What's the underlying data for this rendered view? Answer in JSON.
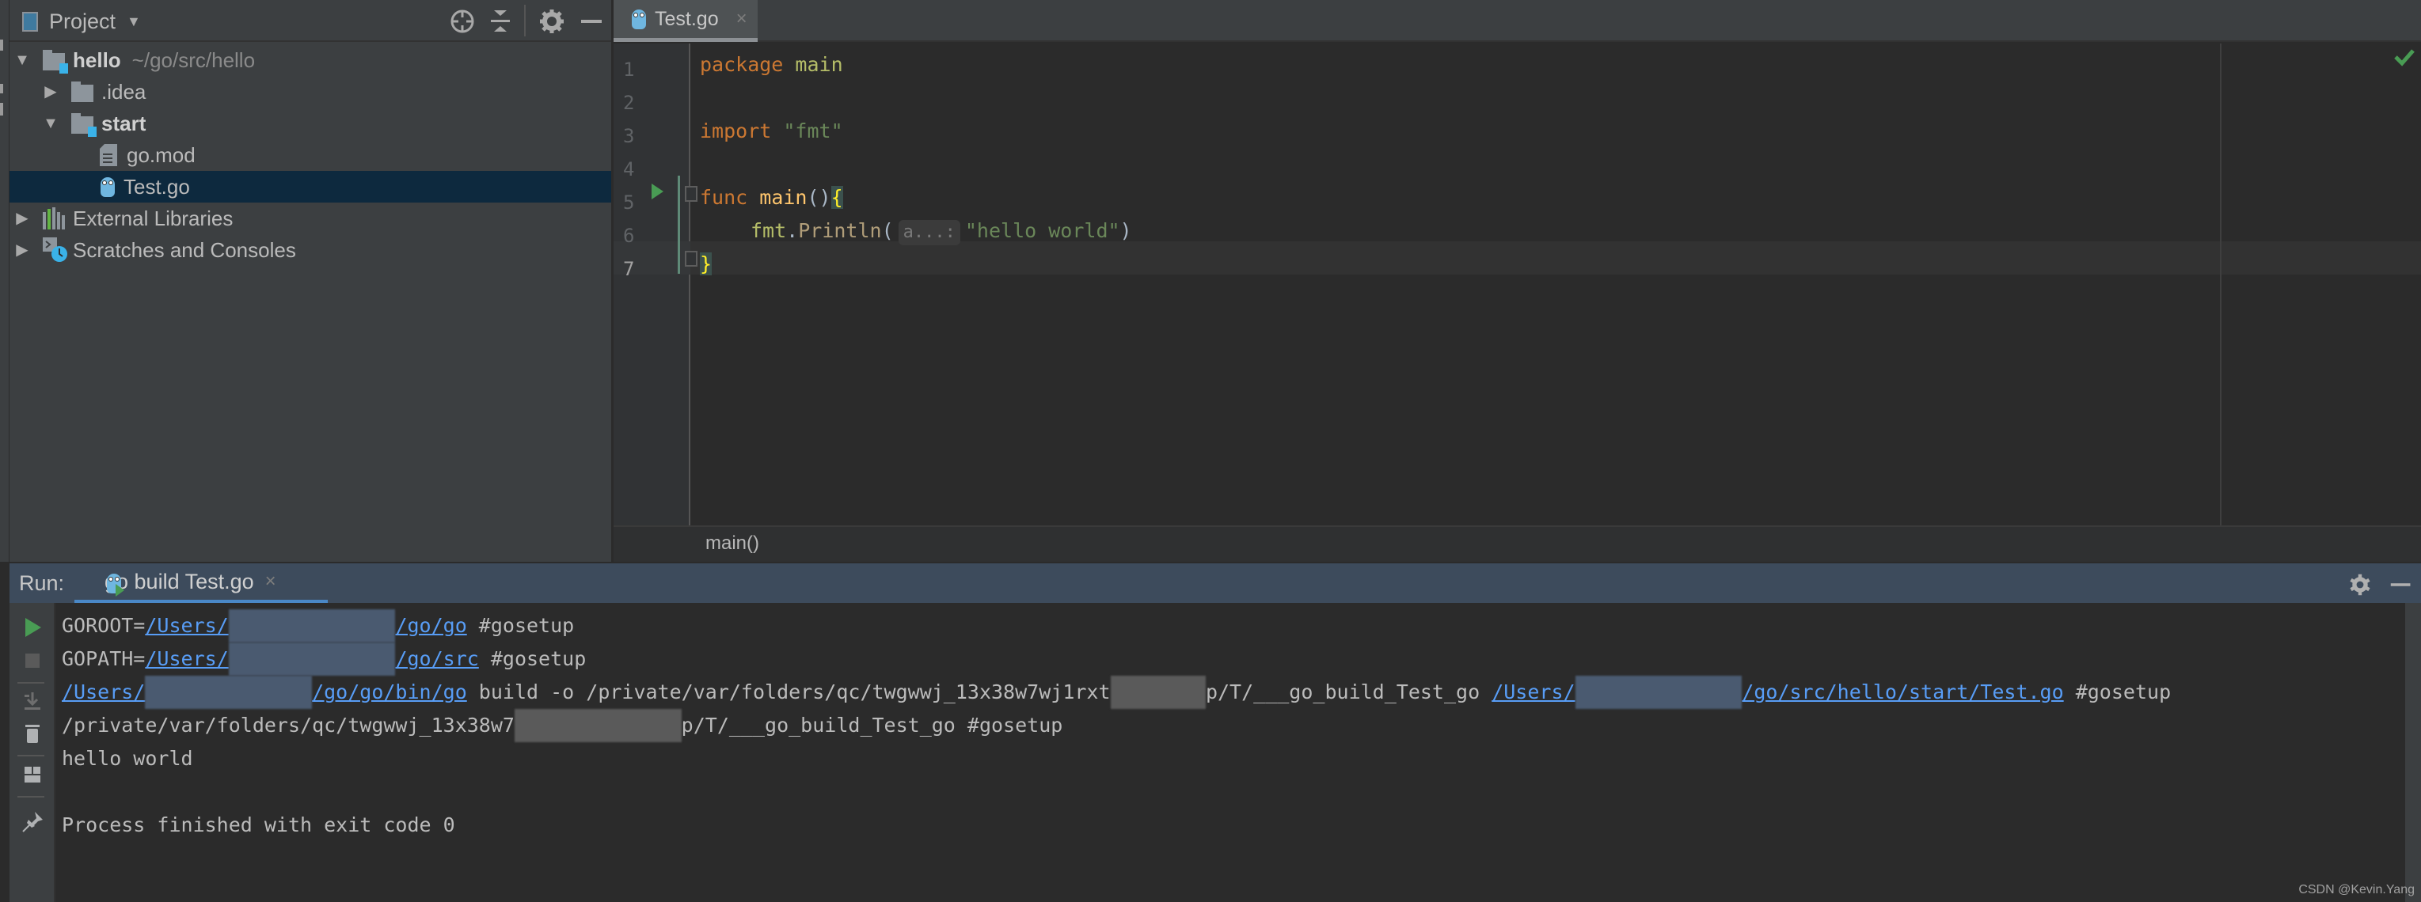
{
  "project_panel": {
    "title": "Project",
    "header_icons": [
      "locate-icon",
      "collapse-all-icon",
      "gear-icon",
      "minimize-icon"
    ],
    "tree": [
      {
        "label": "hello",
        "detail": "~/go/src/hello",
        "type": "module-folder",
        "expanded": true,
        "depth": 0
      },
      {
        "label": ".idea",
        "type": "folder",
        "expanded": false,
        "depth": 1
      },
      {
        "label": "start",
        "type": "module-folder",
        "expanded": true,
        "depth": 1
      },
      {
        "label": "go.mod",
        "type": "file",
        "depth": 2
      },
      {
        "label": "Test.go",
        "type": "go-file",
        "depth": 2,
        "selected": true
      },
      {
        "label": "External Libraries",
        "type": "libraries",
        "expanded": false,
        "depth": 0
      },
      {
        "label": "Scratches and Consoles",
        "type": "scratches",
        "expanded": false,
        "depth": 0
      }
    ]
  },
  "editor": {
    "tab": {
      "label": "Test.go",
      "close": "×"
    },
    "line_numbers": [
      "1",
      "2",
      "3",
      "4",
      "5",
      "6",
      "7"
    ],
    "current_line": 7,
    "code": {
      "l1_kw": "package",
      "l1_name": "main",
      "l3_kw": "import",
      "l3_str": "\"fmt\"",
      "l5_kw": "func",
      "l5_fn": "main",
      "l5_parens": "()",
      "l5_brace": "{",
      "l6_pkg": "fmt",
      "l6_dot": ".",
      "l6_call": "Println",
      "l6_open": "(",
      "l6_hint": "a...:",
      "l6_str": "\"hello world\"",
      "l6_close": ")",
      "l7_brace": "}"
    },
    "breadcrumb": "main()",
    "inspection_status": "ok"
  },
  "run_panel": {
    "label": "Run:",
    "tab": {
      "label": "go build Test.go",
      "close": "×"
    },
    "console": {
      "l1_prefix": "GOROOT=",
      "l1_link_a": "/Users/",
      "l1_redacted": "xxxxxxxxxxxxxx",
      "l1_link_b": "/go/go",
      "l1_suffix": " #gosetup",
      "l2_prefix": "GOPATH=",
      "l2_link_a": "/Users/",
      "l2_redacted": "xxxxxxxxxxxxxx",
      "l2_link_b": "/go/src",
      "l2_suffix": " #gosetup",
      "l3_link_a": "/Users/",
      "l3_redacted": "xxxxxxxxxxxxxx",
      "l3_link_b": "/go/go/bin/go",
      "l3_mid": " build -o /private/var/folders/qc/twgwwj_13x38w7wj1rxt",
      "l3_redacted2": "xxxxxxxx",
      "l3_mid2": "p/T/___go_build_Test_go ",
      "l3_link2_a": "/Users/",
      "l3_redacted3": "xxxxxxxxxxxxxx",
      "l3_link2_b": "/go/src/hello/start/Test.go",
      "l3_suffix": " #gosetup",
      "l4_a": "/private/var/folders/qc/twgwwj_13x38w7",
      "l4_redacted": "xxxxxxxxxxxxxx",
      "l4_b": "p/T/___go_build_Test_go #gosetup",
      "l5": "hello world",
      "l6": "",
      "l7": "Process finished with exit code 0"
    }
  },
  "watermark": "CSDN @Kevin.Yang",
  "colors": {
    "keyword": "#cc7832",
    "string": "#6a8759",
    "function": "#ffc66d",
    "link": "#589df6",
    "run_green": "#499c54",
    "selection": "#0d293e",
    "run_header": "#3d4b5c",
    "tab_underline": "#4a88c7"
  }
}
